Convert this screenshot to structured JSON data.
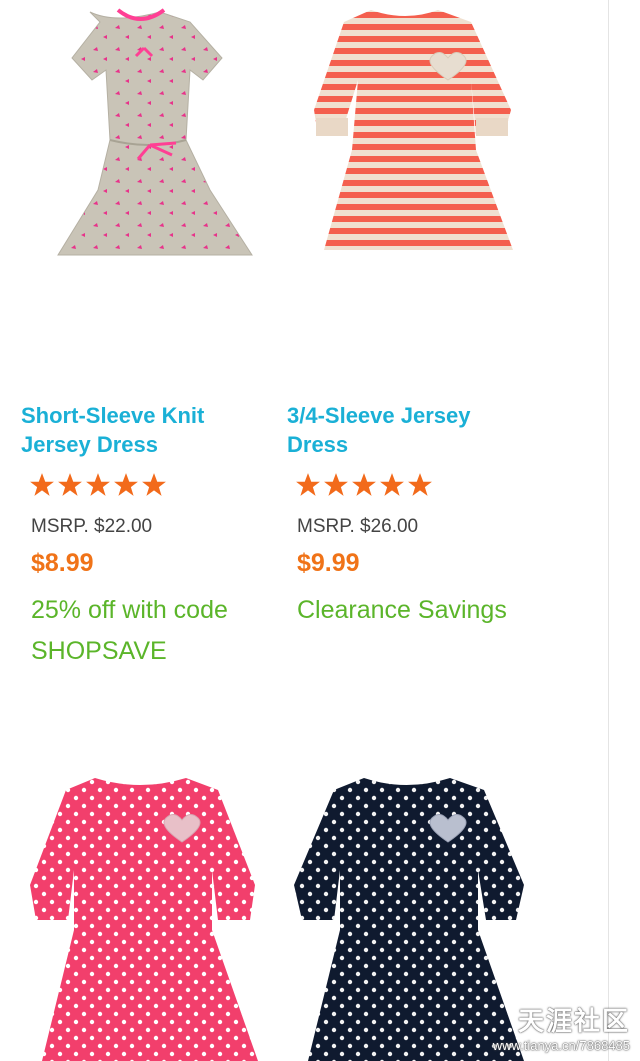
{
  "products": [
    {
      "title": "Short-Sleeve Knit Jersey Dress",
      "image": "gray-print-short-sleeve-dress",
      "rating": 5,
      "msrp": "MSRP. $22.00",
      "price": "$8.99",
      "promo": "25% off with code SHOPSAVE"
    },
    {
      "title": "3/4-Sleeve Jersey Dress",
      "image": "coral-striped-dress",
      "rating": 5,
      "msrp": "MSRP. $26.00",
      "price": "$9.99",
      "promo": "Clearance Savings"
    },
    {
      "image": "pink-polka-dot-dress"
    },
    {
      "image": "navy-polka-dot-dress"
    }
  ],
  "colors": {
    "title": "#1ab0d6",
    "star": "#f26a1b",
    "price": "#f07318",
    "promo": "#5bb52a",
    "msrp": "#444444"
  },
  "watermark": {
    "logo": "天涯社区",
    "url": "www.tianya.cn/7868485"
  }
}
